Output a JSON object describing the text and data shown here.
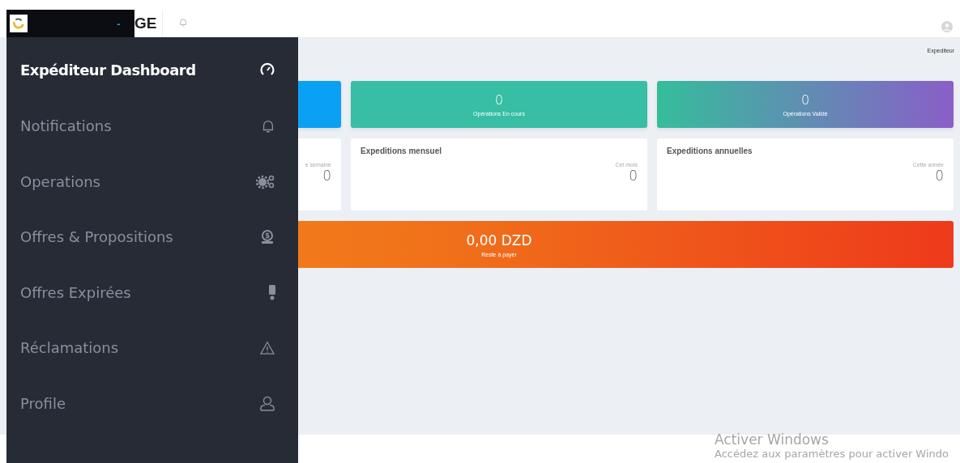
{
  "header": {
    "brand_fragment": "GE",
    "collapse_glyph": "-"
  },
  "breadcrumb": "Expediteur",
  "stat_cards": [
    {
      "kind": "blue"
    },
    {
      "kind": "green",
      "value": "0",
      "label": "Opérations En cours"
    },
    {
      "kind": "gradient",
      "value": "0",
      "label": "Opérations Validé"
    }
  ],
  "expedition_cards": [
    {
      "period": "e semaine",
      "value": "0"
    },
    {
      "title": "Expeditions mensuel",
      "period": "Cet mois",
      "value": "0"
    },
    {
      "title": "Expeditions annuelles",
      "period": "Cette année",
      "value": "0"
    }
  ],
  "balance": {
    "amount": "0,00 DZD",
    "label": "Reste à payer"
  },
  "sidebar": {
    "items": [
      {
        "label": "Expéditeur Dashboard",
        "selected": true
      },
      {
        "label": "Notifications",
        "selected": false
      },
      {
        "label": "Operations",
        "selected": false
      },
      {
        "label": "Offres & Propositions",
        "selected": false
      },
      {
        "label": "Offres Expirées",
        "selected": false
      },
      {
        "label": "Réclamations",
        "selected": false
      },
      {
        "label": "Profile",
        "selected": false
      }
    ]
  },
  "activation_notice": {
    "title": "Activer Windows",
    "text": "Accédez aux paramètres pour activer Windo"
  }
}
